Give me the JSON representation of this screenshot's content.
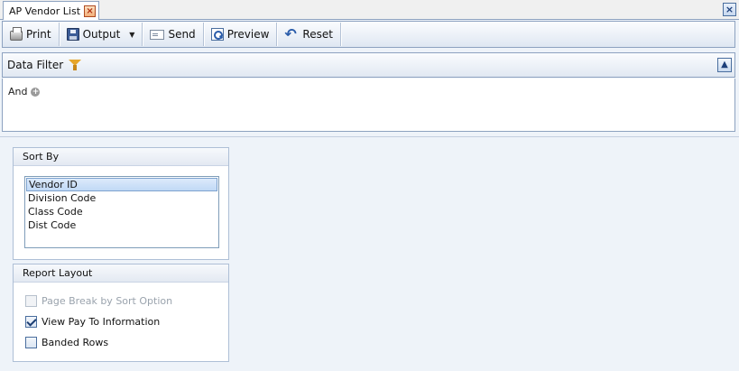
{
  "tab": {
    "title": "AP Vendor List"
  },
  "toolbar": {
    "print": "Print",
    "output": "Output",
    "send": "Send",
    "preview": "Preview",
    "reset": "Reset"
  },
  "data_filter": {
    "title": "Data Filter",
    "operator": "And"
  },
  "sort_by": {
    "title": "Sort By",
    "options": [
      "Vendor ID",
      "Division Code",
      "Class Code",
      "Dist Code"
    ],
    "selected": "Vendor ID"
  },
  "report_layout": {
    "title": "Report Layout",
    "options": [
      {
        "label": "Page Break by Sort Option",
        "checked": false,
        "enabled": false
      },
      {
        "label": "View Pay To Information",
        "checked": true,
        "enabled": true
      },
      {
        "label": "Banded Rows",
        "checked": false,
        "enabled": true
      }
    ]
  },
  "icons": {
    "tab_close": "close-icon",
    "window_close": "close-icon",
    "print": "printer-icon",
    "output": "save-icon",
    "send": "envelope-icon",
    "preview": "magnifier-icon",
    "reset": "undo-icon",
    "filter": "funnel-icon",
    "collapse": "collapse-icon",
    "add": "plus-icon"
  }
}
